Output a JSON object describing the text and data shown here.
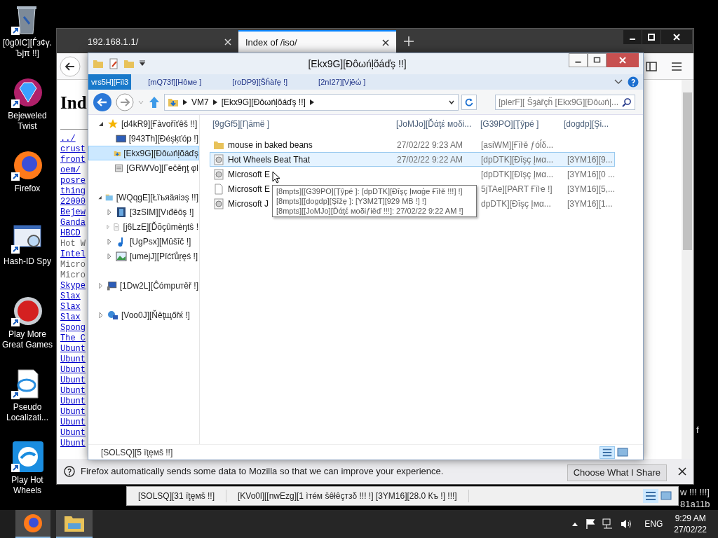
{
  "desktop_icons": [
    {
      "label": "[0g0IC][Ѓз¢γ. Ъјπ !!]",
      "kind": "trash"
    },
    {
      "label": "Bejeweled Twist",
      "kind": "gem"
    },
    {
      "label": "Firefox",
      "kind": "browser"
    },
    {
      "label": "Hash-ID Spy",
      "kind": "hash"
    },
    {
      "label": "Play More Great Games",
      "kind": "ball"
    },
    {
      "label": "Pseudo Localizati...",
      "kind": "page"
    },
    {
      "label": "Play Hot Wheels",
      "kind": "swirl"
    }
  ],
  "browser": {
    "tabs": [
      {
        "label": "192.168.1.1/",
        "selected": false
      },
      {
        "label": "Index of /iso/",
        "selected": true
      }
    ],
    "heading": "Ind",
    "links": [
      {
        "text": "../",
        "visited": false
      },
      {
        "text": "crust",
        "visited": false
      },
      {
        "text": "front",
        "visited": false
      },
      {
        "text": "oem/",
        "visited": false
      },
      {
        "text": "posre",
        "visited": false
      },
      {
        "text": "thing",
        "visited": false
      },
      {
        "text": "22000",
        "visited": false
      },
      {
        "text": "Bejew",
        "visited": false
      },
      {
        "text": "Ganda",
        "visited": false
      },
      {
        "text": "HBCD",
        "visited": false
      },
      {
        "text": "Hot W",
        "visited": true
      },
      {
        "text": "Intel",
        "visited": false
      },
      {
        "text": "Micro",
        "visited": true
      },
      {
        "text": "Micro",
        "visited": true
      },
      {
        "text": "Skype",
        "visited": false
      },
      {
        "text": "Slax",
        "visited": false
      },
      {
        "text": "Slax",
        "visited": false
      },
      {
        "text": "Slax",
        "visited": false
      },
      {
        "text": "Spong",
        "visited": false
      },
      {
        "text": "The C",
        "visited": false
      },
      {
        "text": "Ubunt",
        "visited": false
      },
      {
        "text": "Ubunt",
        "visited": false
      },
      {
        "text": "Ubunt",
        "visited": false
      },
      {
        "text": "Ubunt",
        "visited": false
      },
      {
        "text": "Ubunt",
        "visited": false
      },
      {
        "text": "Ubunt",
        "visited": false
      },
      {
        "text": "Ubunt",
        "visited": false
      },
      {
        "text": "Ubunt",
        "visited": false
      },
      {
        "text": "Ubunt",
        "visited": false
      },
      {
        "text": "Ubunt",
        "visited": false
      }
    ],
    "notification": {
      "text": "Firefox automatically sends some data to Mozilla so that we can improve your experience.",
      "button": "Choose What I Share"
    }
  },
  "explorer": {
    "title": "[Ekx9G][Đôωńļõáďş !!]",
    "ribbon_tabs": [
      {
        "label": "vrs5H][Fïl3",
        "selected": true
      },
      {
        "label": "[mQ73f][Hôмe ]",
        "selected": false
      },
      {
        "label": "[roDP9][Šĥàřę !]",
        "selected": false
      },
      {
        "label": "[2nI27][Vįēώ ]",
        "selected": false
      }
    ],
    "address": [
      "VM7",
      "[Ekx9G][Đôωńļõáďş !!]"
    ],
    "search": {
      "placeholder": "[plerF][ Šȝàřçĥ [Ekx9G][Đôωń|..."
    },
    "tree": [
      {
        "label": "[d4kR9][Ғàvořīťêš !!]",
        "kind": "star",
        "expanded": true,
        "selected": false,
        "children": [
          {
            "label": "[943Th][Đéşķťóp !]",
            "kind": "desktop",
            "selected": false
          },
          {
            "label": "[Ekx9G][Đôωńļõáďş",
            "kind": "download",
            "selected": true
          },
          {
            "label": "[GRWVo][Гečěŋţ φl",
            "kind": "recent",
            "selected": false
          }
        ]
      },
      {
        "label": "[WQqgE][Łïъяäяiэş !!]",
        "kind": "library",
        "expanded": true,
        "selected": false,
        "children": [
          {
            "label": "[3zSIM][Vıđēōş !]",
            "kind": "film",
            "expanded": false,
            "selected": false
          },
          {
            "label": "[j6LzE][Ďõçûmèŋtŝ !",
            "kind": "doc",
            "expanded": false,
            "selected": false
          },
          {
            "label": "[UgPsx][Mūšīč !]",
            "kind": "music",
            "expanded": false,
            "selected": false
          },
          {
            "label": "[umejJ][Pïćťůŗęś !]",
            "kind": "image",
            "expanded": false,
            "selected": false
          }
        ]
      },
      {
        "label": "[1Dw2L][Ĉómpuтěř !]",
        "kind": "computer",
        "expanded": false,
        "selected": false
      },
      {
        "label": "[Voo0J][Ňěţщőřќ !]",
        "kind": "network",
        "expanded": false,
        "selected": false
      }
    ],
    "columns": [
      "[9gGf5][Ƞāmë ]",
      "[JoMJo][Ďάţέ мoδі...",
      "[G39PO][Ţŷpé ]",
      "[dogdp][Şi..."
    ],
    "files": [
      {
        "kind": "folder",
        "name": "mouse in baked beans",
        "date": "27/02/22 9:23 AM",
        "type": "[asiWM][Ғīŀě ƒóĺδ...",
        "selected": false
      },
      {
        "kind": "disc",
        "name": "Hot Wheels Beat That",
        "date": "27/02/22 9:22 AM",
        "type": "[dpDTK][Đīşç Įмα...",
        "size": "[3YM16][9...",
        "selected": true
      },
      {
        "kind": "disc",
        "name": "Microsoft E",
        "type": "[dpDTK][Đīşç Įмα...",
        "size": "[3YM16][0 ...",
        "selected": false
      },
      {
        "kind": "file",
        "name": "Microsoft E",
        "type": "5jTAe][PART Ғīŀe !]",
        "size": "[3YM16][5,...",
        "selected": false
      },
      {
        "kind": "disc",
        "name": "Microsoft J",
        "type": "dpDTK][Đīşç Įмα...",
        "size": "[3YM16][1...",
        "selected": false
      }
    ],
    "tooltip": [
      "[8mpts][[G39PO][Ţŷpé ]: [dpDTK][Đīşç Įмαģe Ғīŀě !!!] !]",
      "[8mpts][[dogdp][Şīžę ]: [Y3M2T][929 MB !] !]",
      "[8mpts][[JoMJo][Ďάţέ мoδіƒіěď !!!]: 27/02/22 9:22 AM !]"
    ],
    "status": "[SOLSQ][5 ïţęмš !!]"
  },
  "background_window": {
    "status": [
      "[SOLSQ][31 ïţęмš !!]",
      "[KVo0l][[nwEzg][1 ìтéм šêłêçтзδ !!! !]  [3YM16][28.0 Къ !] !!!]"
    ],
    "fragments": [
      "f",
      "w !!! !!!]",
      "81a11b"
    ]
  },
  "taskbar": {
    "language": "ENG",
    "time": "9:29 AM",
    "date": "27/02/22"
  }
}
